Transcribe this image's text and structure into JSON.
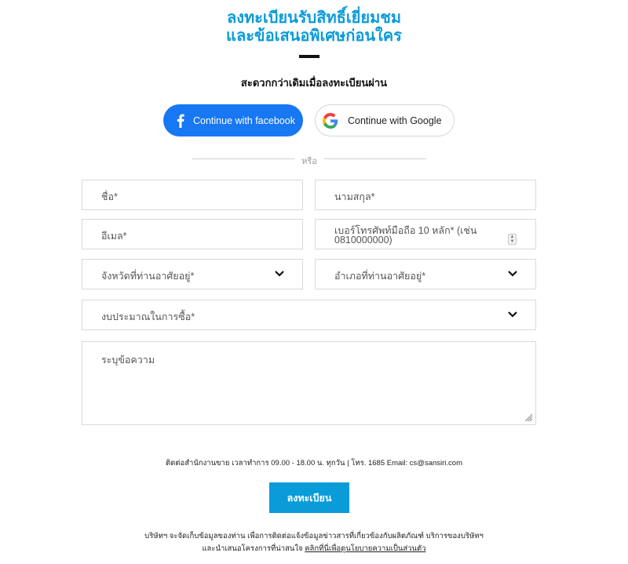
{
  "header": {
    "title_line1": "ลงทะเบียนรับสิทธิ์เยี่ยมชม",
    "title_line2": "และข้อเสนอพิเศษก่อนใคร",
    "subtitle": "สะดวกกว่าเดิมเมื่อลงทะเบียนผ่าน",
    "accent_color": "#0a9bd9"
  },
  "social": {
    "facebook_label": "Continue with facebook",
    "facebook_icon": "facebook-icon",
    "google_label": "Continue with Google",
    "google_icon": "google-icon",
    "facebook_color": "#1877f2"
  },
  "separator": {
    "or_text": "หรือ"
  },
  "form": {
    "first_name_placeholder": "ชื่อ*",
    "last_name_placeholder": "นามสกุล*",
    "email_placeholder": "อีเมล*",
    "phone_placeholder": "เบอร์โทรศัพท์มือถือ 10 หลัก* (เช่น 0810000000)",
    "province_placeholder": "จังหวัดที่ท่านอาศัยอยู่*",
    "district_placeholder": "อำเภอที่ท่านอาศัยอยู่*",
    "budget_placeholder": "งบประมาณในการซื้อ*",
    "message_placeholder": "ระบุข้อความ"
  },
  "footer": {
    "contact_text": "ติดต่อสำนักงานขาย เวลาทำการ 09.00 - 18.00 น. ทุกวัน | โทร. 1685 Email: cs@sansiri.com",
    "submit_label": "ลงทะเบียน",
    "privacy_line1": "บริษัทฯ จะจัดเก็บข้อมูลของท่าน เพื่อการติดต่อแจ้งข้อมูลข่าวสารที่เกี่ยวข้องกับผลิตภัณฑ์ บริการของบริษัทฯ",
    "privacy_line2_prefix": "และนำเสนอโครงการที่น่าสนใจ",
    "privacy_link": "คลิกที่นี่เพื่อดูนโยบายความเป็นส่วนตัว"
  }
}
